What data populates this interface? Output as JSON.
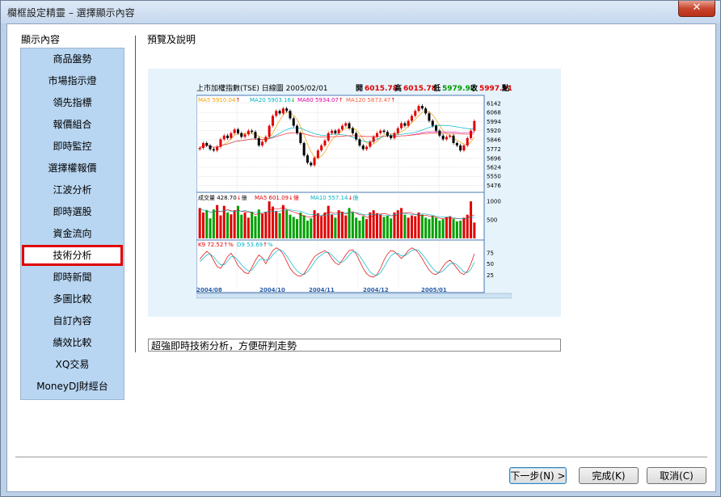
{
  "window": {
    "title": "欄框設定精靈 – 選擇顯示內容",
    "close_label": "✕"
  },
  "sidebar": {
    "header": "顯示內容",
    "items": [
      {
        "label": "商品盤勢"
      },
      {
        "label": "市場指示燈"
      },
      {
        "label": "領先指標"
      },
      {
        "label": "報價組合"
      },
      {
        "label": "即時監控"
      },
      {
        "label": "選擇權報價"
      },
      {
        "label": "江波分析"
      },
      {
        "label": "即時選股"
      },
      {
        "label": "資金流向"
      },
      {
        "label": "技術分析",
        "selected": true
      },
      {
        "label": "即時新聞"
      },
      {
        "label": "多圖比較"
      },
      {
        "label": "自訂內容"
      },
      {
        "label": "績效比較"
      },
      {
        "label": "XQ交易"
      },
      {
        "label": "MoneyDJ財經台"
      }
    ]
  },
  "preview": {
    "header": "預覽及說明",
    "description": "超強即時技術分析，方便研判走勢"
  },
  "buttons": {
    "next": "下一步(N) >",
    "finish": "完成(K)",
    "cancel": "取消(C)"
  },
  "chart_data": {
    "type": "candlestick",
    "title": "上市加權指數(TSE)  日線圖  2005/02/01",
    "ohlc_header": {
      "open_label": "開",
      "open": "6015.78",
      "high_label": "高",
      "high": "6015.78",
      "low_label": "低",
      "low": "5979.92",
      "close_label": "收",
      "close": "5997.91",
      "suffix": "點"
    },
    "ma_legend": [
      {
        "label": "MA5 5910.04",
        "arrow": "↑",
        "color": "#f0a000"
      },
      {
        "label": "MA20 5903.16",
        "arrow": "↓",
        "color": "#00b4c8"
      },
      {
        "label": "MA60 5934.07",
        "arrow": "↑",
        "color": "#e000a0"
      },
      {
        "label": "MA120 5873.47",
        "arrow": "↑",
        "color": "#f06040"
      }
    ],
    "price_ticks": [
      "6142",
      "6068",
      "5994",
      "5920",
      "5846",
      "5772",
      "5696",
      "5624",
      "5550",
      "5476"
    ],
    "ylim": [
      5440,
      6180
    ],
    "volume_legend": [
      {
        "label": "成交量 428.70",
        "arrow": "↓",
        "suffix": "億",
        "color": "#000000"
      },
      {
        "label": "MA5 601.09",
        "arrow": "↓",
        "suffix": "億",
        "color": "#e00000"
      },
      {
        "label": "MA10 557.14",
        "arrow": "↓",
        "suffix": "億",
        "color": "#00b4c8"
      }
    ],
    "volume_ticks": [
      "1000",
      "500"
    ],
    "kd_legend": [
      {
        "label": "K9 72.52",
        "arrow": "↑",
        "suffix": "%",
        "color": "#e00000"
      },
      {
        "label": "D9 53.69",
        "arrow": "↑",
        "suffix": "%",
        "color": "#00b4c8"
      }
    ],
    "kd_ticks": [
      "75",
      "50",
      "25"
    ],
    "x_ticks": [
      "2004/08",
      "2004/10",
      "2004/11",
      "2004/12",
      "2005/01"
    ],
    "closes": [
      5780,
      5820,
      5800,
      5770,
      5760,
      5790,
      5850,
      5880,
      5860,
      5900,
      5930,
      5900,
      5870,
      5890,
      5920,
      5910,
      5860,
      5800,
      5830,
      5870,
      5960,
      6040,
      6080,
      6060,
      6100,
      6080,
      6020,
      5960,
      5900,
      5820,
      5720,
      5660,
      5640,
      5700,
      5760,
      5800,
      5840,
      5900,
      5920,
      5900,
      5930,
      5960,
      5980,
      5940,
      5900,
      5850,
      5800,
      5770,
      5790,
      5830,
      5870,
      5900,
      5920,
      5910,
      5880,
      5860,
      5900,
      5940,
      5980,
      5960,
      6000,
      6040,
      6080,
      6120,
      6100,
      6060,
      6000,
      5960,
      5920,
      5880,
      5850,
      5870,
      5880,
      5820,
      5800,
      5760,
      5800,
      5860,
      5920,
      5998
    ],
    "volumes": [
      820,
      700,
      760,
      540,
      780,
      900,
      620,
      880,
      700,
      650,
      760,
      880,
      640,
      700,
      560,
      720,
      600,
      780,
      660,
      720,
      1000,
      860,
      740,
      680,
      900,
      760,
      640,
      580,
      520,
      700,
      620,
      480,
      540,
      760,
      680,
      600,
      700,
      880,
      640,
      560,
      760,
      720,
      620,
      820,
      700,
      560,
      480,
      600,
      520,
      700,
      760,
      680,
      640,
      580,
      620,
      540,
      700,
      760,
      820,
      640,
      560,
      620,
      600,
      700,
      640,
      560,
      520,
      600,
      560,
      480,
      520,
      580,
      600,
      520,
      460,
      480,
      560,
      640,
      1000,
      429
    ],
    "k_values": [
      60,
      70,
      78,
      72,
      58,
      44,
      40,
      52,
      66,
      74,
      62,
      46,
      38,
      30,
      28,
      42,
      58,
      70,
      64,
      50,
      66,
      80,
      86,
      82,
      72,
      56,
      40,
      30,
      24,
      22,
      28,
      40,
      54,
      66,
      72,
      76,
      80,
      74,
      62,
      52,
      48,
      58,
      70,
      80,
      82,
      72,
      56,
      40,
      28,
      22,
      20,
      26,
      40,
      58,
      72,
      80,
      78,
      70,
      62,
      70,
      80,
      86,
      82,
      74,
      62,
      48,
      36,
      28,
      26,
      32,
      44,
      54,
      58,
      50,
      40,
      30,
      26,
      34,
      50,
      72.52
    ],
    "d_values": [
      55,
      62,
      70,
      72,
      66,
      56,
      48,
      48,
      56,
      66,
      66,
      58,
      48,
      40,
      34,
      36,
      46,
      58,
      62,
      58,
      60,
      70,
      78,
      82,
      78,
      68,
      56,
      44,
      34,
      28,
      26,
      32,
      42,
      54,
      64,
      70,
      76,
      76,
      70,
      62,
      54,
      54,
      60,
      70,
      78,
      76,
      68,
      56,
      44,
      32,
      26,
      24,
      30,
      42,
      56,
      68,
      74,
      74,
      68,
      68,
      74,
      80,
      82,
      80,
      72,
      62,
      50,
      40,
      32,
      30,
      34,
      42,
      50,
      52,
      48,
      40,
      32,
      30,
      38,
      53.69
    ]
  }
}
